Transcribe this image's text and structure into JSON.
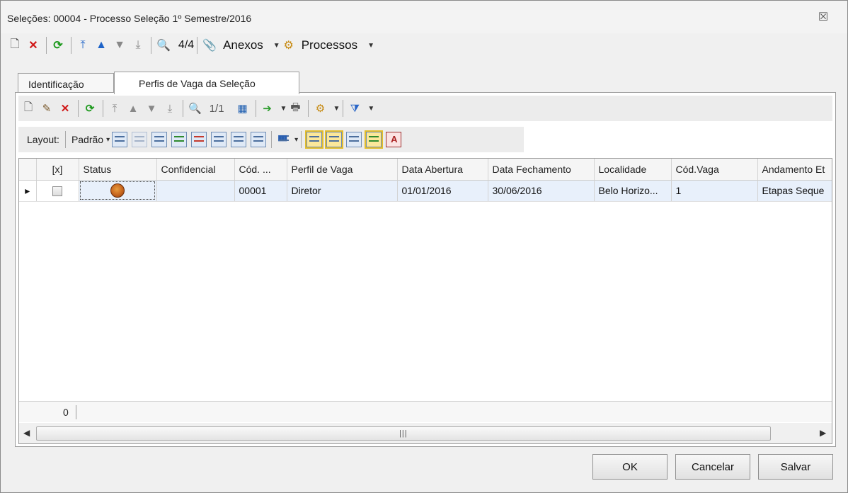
{
  "window": {
    "title": "Seleções: 00004 - Processo Seleção 1º Semestre/2016",
    "close_glyph": "☒"
  },
  "main_toolbar": {
    "record_counter": "4/4",
    "anexos_label": "Anexos",
    "processos_label": "Processos",
    "icons": {
      "new": "🗋",
      "delete": "✕",
      "refresh": "⟳",
      "first": "⤒",
      "prev": "▲",
      "next": "▼",
      "last": "⤓",
      "find": "🔍",
      "clip": "📎",
      "gear": "⚙",
      "dropdown": "▼"
    }
  },
  "tabs": [
    {
      "label": "Identificação",
      "active": false
    },
    {
      "label": "Perfis de Vaga da Seleção",
      "active": true
    }
  ],
  "sub_toolbar": {
    "page_counter": "1/1",
    "icons": {
      "new": "🗋",
      "edit": "✎",
      "delete": "✕",
      "refresh": "⟳",
      "first": "⤒",
      "prev": "▲",
      "next": "▼",
      "last": "⤓",
      "find": "🔍",
      "calendar": "▦",
      "export": "➔",
      "print": "🖶",
      "gear": "⚙",
      "filter": "⧩",
      "dropdown": "▼"
    }
  },
  "layout_bar": {
    "label": "Layout:",
    "selected": "Padrão",
    "dropdown": "▾",
    "chart_glyph": "▮▮▮",
    "letter_glyph": "A"
  },
  "grid": {
    "columns": [
      "[x]",
      "Status",
      "Confidencial",
      "Cód. ...",
      "Perfil de Vaga",
      "Data Abertura",
      "Data Fechamento",
      "Localidade",
      "Cód.Vaga",
      "Andamento Et"
    ],
    "rows": [
      {
        "indicator": "▸",
        "codigo": "00001",
        "perfil": "Diretor",
        "data_abertura": "01/01/2016",
        "data_fechamento": "30/06/2016",
        "localidade": "Belo Horizo...",
        "cod_vaga": "1",
        "andamento": "Etapas Seque"
      }
    ],
    "status_color": "#c7651e",
    "footer_count": "0",
    "scroll": {
      "left": "◀",
      "right": "▶",
      "grip": "|||"
    }
  },
  "buttons": {
    "ok": "OK",
    "cancel": "Cancelar",
    "save": "Salvar"
  }
}
